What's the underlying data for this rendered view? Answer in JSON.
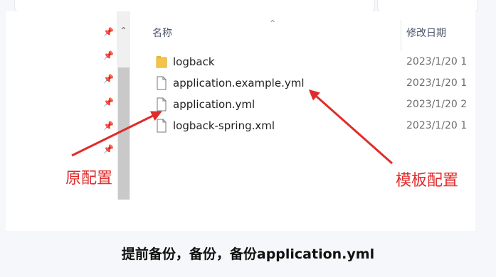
{
  "explorer": {
    "column_name": "名称",
    "column_date": "修改日期",
    "files": [
      {
        "name": "logback",
        "date": "2023/1/20 1",
        "icon": "folder-icon"
      },
      {
        "name": "application.example.yml",
        "date": "2023/1/20 1",
        "icon": "file-icon"
      },
      {
        "name": "application.yml",
        "date": "2023/1/20 2",
        "icon": "file-icon"
      },
      {
        "name": "logback-spring.xml",
        "date": "2023/1/20 1",
        "icon": "file-icon"
      }
    ]
  },
  "annotations": {
    "original_config": "原配置",
    "template_config": "模板配置"
  },
  "caption": "提前备份，备份，备份application.yml",
  "colors": {
    "annotation": "#e02b2b",
    "folder": "#f3c447",
    "background": "#f6f7fa"
  }
}
